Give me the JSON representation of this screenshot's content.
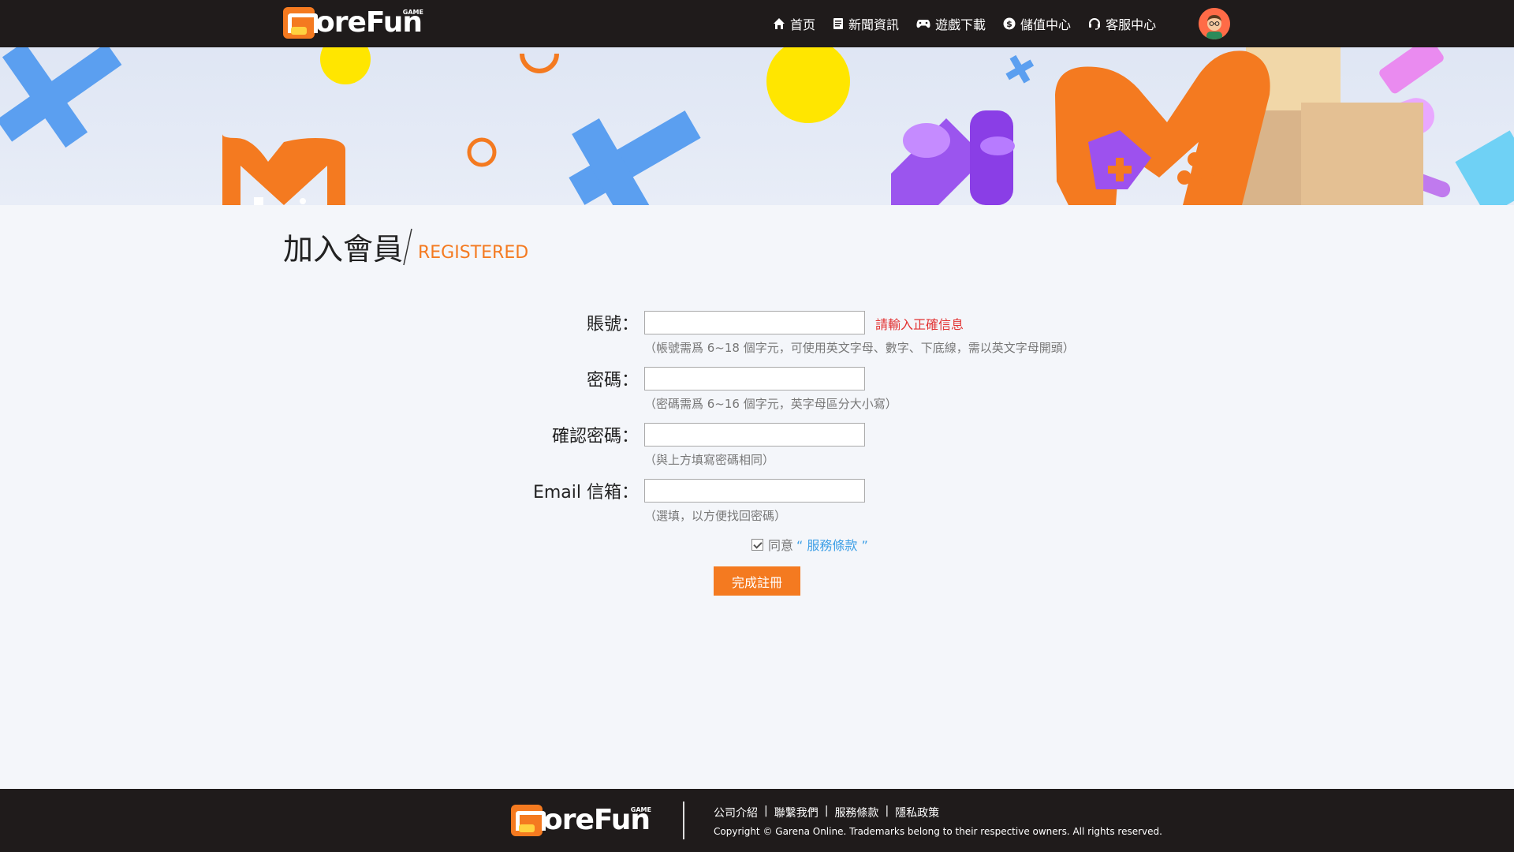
{
  "header": {
    "logo_text": "oreFun",
    "logo_super": "GAME",
    "nav": [
      {
        "label": "首页",
        "icon": "home-icon"
      },
      {
        "label": "新聞資訊",
        "icon": "news-icon"
      },
      {
        "label": "遊戲下載",
        "icon": "gamepad-icon"
      },
      {
        "label": "儲值中心",
        "icon": "dollar-icon"
      },
      {
        "label": "客服中心",
        "icon": "headset-icon"
      }
    ]
  },
  "page": {
    "title": "加入會員",
    "subtitle": "REGISTERED"
  },
  "form": {
    "account": {
      "label": "賬號：",
      "value": "",
      "hint": "（帳號需爲 6~18 個字元，可使用英文字母、數字、下底線，需以英文字母開頭）",
      "error": "請輸入正確信息"
    },
    "password": {
      "label": "密碼：",
      "value": "",
      "hint": "（密碼需爲 6~16 個字元，英字母區分大小寫）"
    },
    "confirm": {
      "label": "確認密碼：",
      "value": "",
      "hint": "（與上方填寫密碼相同）"
    },
    "email": {
      "label": "Email 信箱：",
      "value": "",
      "hint": "（選填，以方便找回密碼）"
    },
    "agree_prefix": "同意",
    "agree_link": "“ 服務條款 ”",
    "agree_checked": true,
    "submit_label": "完成註冊"
  },
  "footer": {
    "links": [
      "公司介紹",
      "聯繫我們",
      "服務條款",
      "隱私政策"
    ],
    "separator": "|",
    "copyright": "Copyright © Garena Online. Trademarks belong to their respective owners. All rights reserved."
  },
  "colors": {
    "accent": "#f47a20",
    "dark": "#1f1b1b",
    "error": "#e23232",
    "link": "#3d9fe6"
  }
}
